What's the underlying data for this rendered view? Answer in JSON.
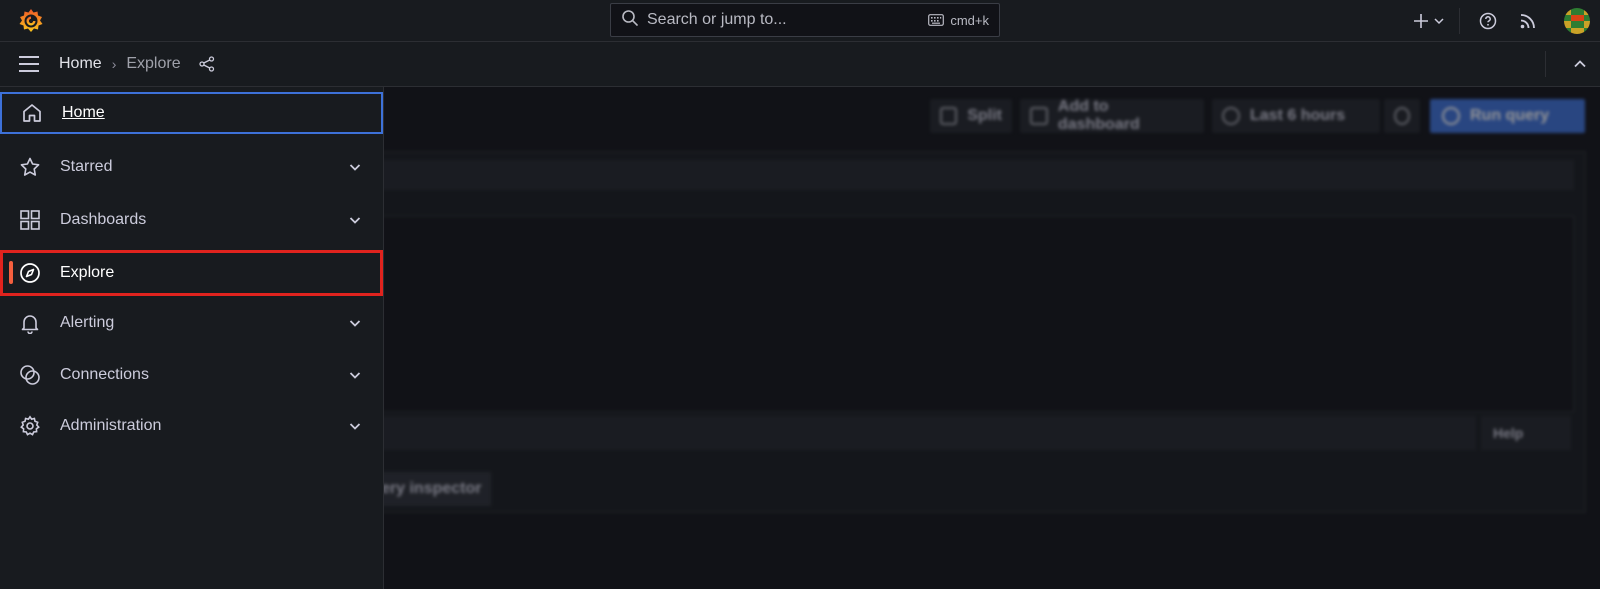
{
  "topbar": {
    "search_placeholder": "Search or jump to...",
    "search_shortcut": "cmd+k",
    "icons": [
      "grafana-logo-icon",
      "search-icon",
      "keyboard-icon",
      "plus-icon",
      "chevron-down-icon",
      "help-icon",
      "rss-icon",
      "avatar"
    ]
  },
  "breadcrumb": {
    "home": "Home",
    "separator": "›",
    "current": "Explore"
  },
  "menu": {
    "items": [
      {
        "label": "Home",
        "icon": "home-icon",
        "expandable": false,
        "focused": true
      },
      {
        "label": "Starred",
        "icon": "star-icon",
        "expandable": true
      },
      {
        "label": "Dashboards",
        "icon": "apps-icon",
        "expandable": true
      },
      {
        "label": "Explore",
        "icon": "compass-icon",
        "expandable": false,
        "active": true
      },
      {
        "label": "Alerting",
        "icon": "bell-icon",
        "expandable": true
      },
      {
        "label": "Connections",
        "icon": "connections-icon",
        "expandable": true
      },
      {
        "label": "Administration",
        "icon": "gear-icon",
        "expandable": true
      }
    ]
  },
  "toolbar": {
    "split_label": "Split",
    "add_to_dashboard_label": "Add to dashboard",
    "time_range_label": "Last 6 hours",
    "run_query_label": "Run query"
  },
  "query_panel": {
    "help_label": "Help",
    "query_inspector_label": "ery inspector"
  },
  "colors": {
    "accent_orange": "#f55f3e",
    "focus_blue": "#3d71d9",
    "highlight_red": "#e0231e",
    "background": "#111217",
    "panel": "#181b1f"
  }
}
